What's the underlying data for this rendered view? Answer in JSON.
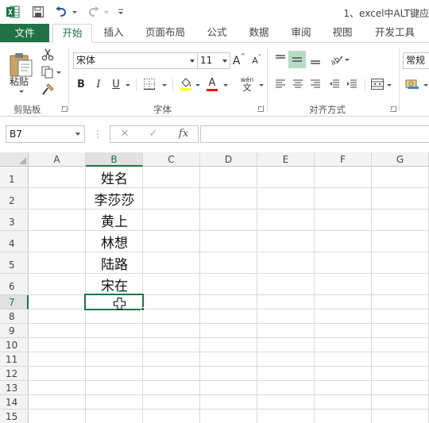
{
  "title": "1、excel中ALT键应",
  "tabs": [
    "文件",
    "开始",
    "插入",
    "页面布局",
    "公式",
    "数据",
    "审阅",
    "视图",
    "开发工具"
  ],
  "ribbon": {
    "clipboard": {
      "paste_label": "粘贴",
      "group_label": "剪贴板"
    },
    "font": {
      "name": "宋体",
      "size": "11",
      "bold": "B",
      "italic": "I",
      "underline": "U",
      "increase": "A",
      "decrease": "A",
      "color": "A",
      "phonetic_top": "wén",
      "phonetic_bottom": "文",
      "group_label": "字体"
    },
    "alignment": {
      "group_label": "对齐方式"
    },
    "number": {
      "format": "常规"
    }
  },
  "formula_bar": {
    "name_box": "B7",
    "cancel": "✕",
    "enter": "✓",
    "fx": "fx",
    "formula": ""
  },
  "sheet": {
    "columns": [
      "A",
      "B",
      "C",
      "D",
      "E",
      "F",
      "G"
    ],
    "rows": [
      "1",
      "2",
      "3",
      "4",
      "5",
      "6",
      "7",
      "8",
      "9",
      "10",
      "11",
      "12",
      "13",
      "14",
      "15"
    ],
    "cells": {
      "B1": "姓名",
      "B2": "李莎莎",
      "B3": "黄上",
      "B4": "林想",
      "B5": "陆路",
      "B6": "宋在"
    },
    "selected_cell": "B7",
    "selected_column": "B",
    "selected_row": "7"
  },
  "colors": {
    "accent": "#217346",
    "header_bg": "#f3f3f3",
    "gridline": "#dadada"
  }
}
